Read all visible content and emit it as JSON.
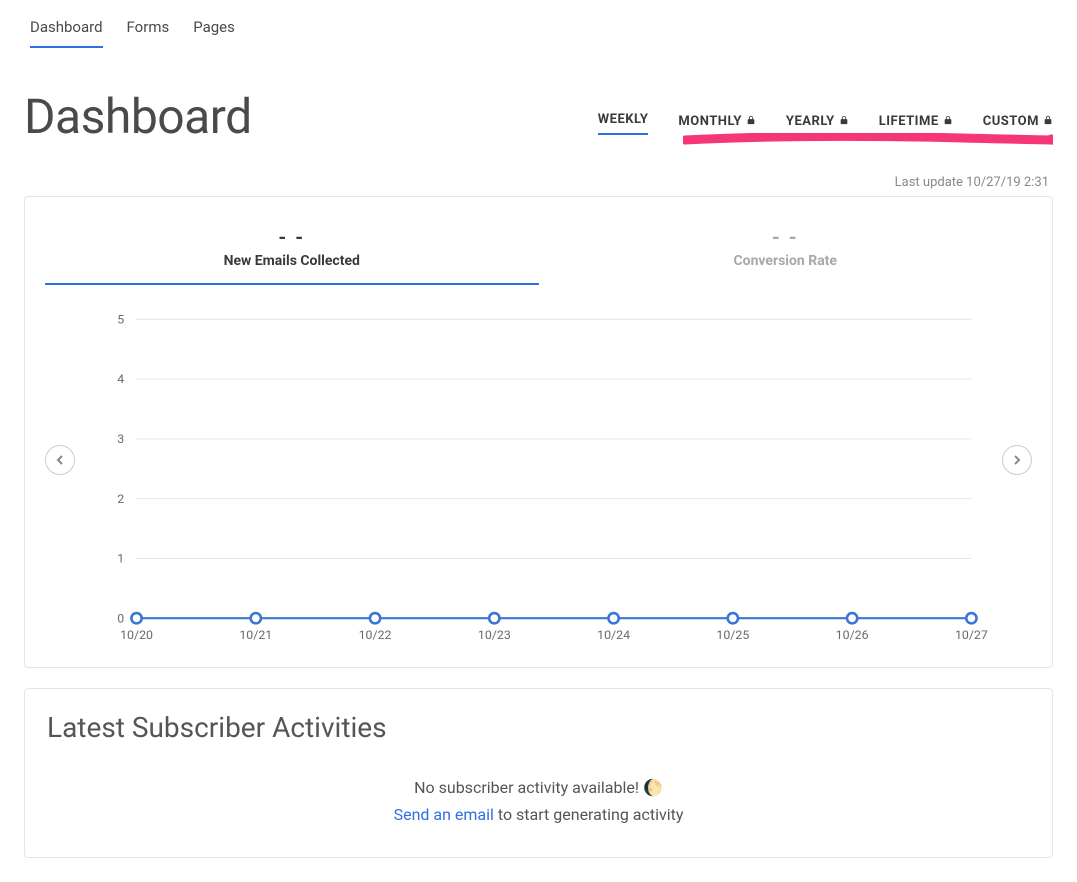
{
  "nav": {
    "items": [
      {
        "label": "Dashboard",
        "name": "nav-dashboard",
        "active": true
      },
      {
        "label": "Forms",
        "name": "nav-forms",
        "active": false
      },
      {
        "label": "Pages",
        "name": "nav-pages",
        "active": false
      }
    ]
  },
  "page": {
    "title": "Dashboard"
  },
  "range_tabs": [
    {
      "label": "WEEKLY",
      "name": "range-weekly",
      "locked": false,
      "active": true
    },
    {
      "label": "MONTHLY",
      "name": "range-monthly",
      "locked": true,
      "active": false
    },
    {
      "label": "YEARLY",
      "name": "range-yearly",
      "locked": true,
      "active": false
    },
    {
      "label": "LIFETIME",
      "name": "range-lifetime",
      "locked": true,
      "active": false
    },
    {
      "label": "CUSTOM",
      "name": "range-custom",
      "locked": true,
      "active": false
    }
  ],
  "last_update": "Last update 10/27/19 2:31",
  "stat_tabs": [
    {
      "value": "- -",
      "label": "New Emails Collected",
      "name": "stat-new-emails",
      "active": true
    },
    {
      "value": "- -",
      "label": "Conversion Rate",
      "name": "stat-conversion-rate",
      "active": false
    }
  ],
  "chart_data": {
    "type": "line",
    "x": [
      "10/20",
      "10/21",
      "10/22",
      "10/23",
      "10/24",
      "10/25",
      "10/26",
      "10/27"
    ],
    "series": [
      {
        "name": "New Emails Collected",
        "values": [
          0,
          0,
          0,
          0,
          0,
          0,
          0,
          0
        ]
      }
    ],
    "ylim": [
      0,
      5
    ],
    "yticks": [
      0,
      1,
      2,
      3,
      4,
      5
    ],
    "xlabel": "",
    "ylabel": ""
  },
  "activities": {
    "title": "Latest Subscriber Activities",
    "message": "No subscriber activity available!",
    "emoji": "🌔",
    "link_text": "Send an email",
    "suffix": " to start generating activity"
  },
  "annotation": {
    "color": "#f53677"
  }
}
